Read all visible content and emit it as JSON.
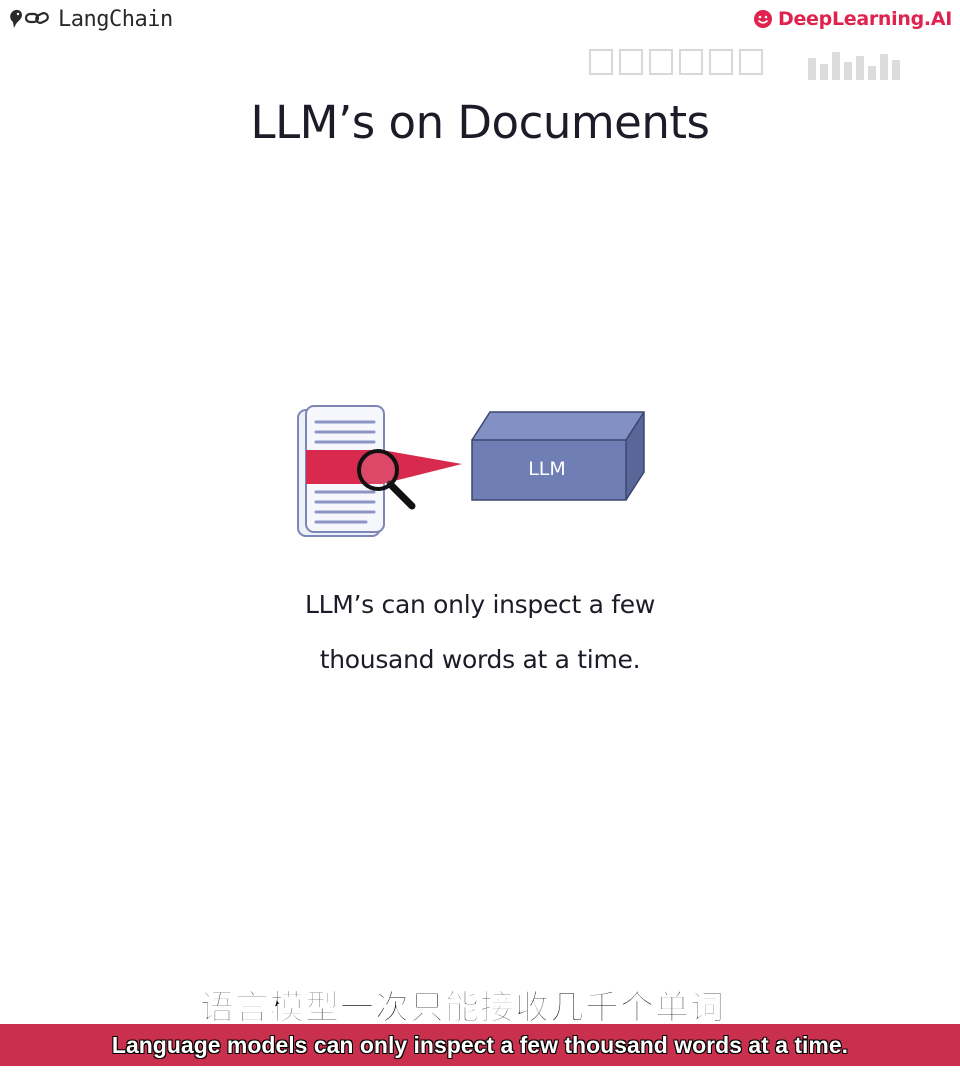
{
  "header": {
    "left_brand": "LangChain",
    "left_logo_icon": "parrot-chain-icon",
    "right_brand": "DeepLearning.AI",
    "right_logo_icon": "smile-icon"
  },
  "slide": {
    "title": "LLM’s on Documents",
    "figure": {
      "document_icon": "document-icon",
      "magnifier_icon": "magnifying-glass-icon",
      "box_label": "LLM",
      "box_color": "#6f7eb5",
      "beam_color": "#d8294f"
    },
    "caption_line1": "LLM’s can only inspect a few",
    "caption_line2": "thousand words at a time."
  },
  "subtitles": {
    "chinese": "语言模型一次只能接收几千个单词。",
    "english": "Language models can only inspect a few thousand words at a time.",
    "bar_color": "#c8304d"
  }
}
